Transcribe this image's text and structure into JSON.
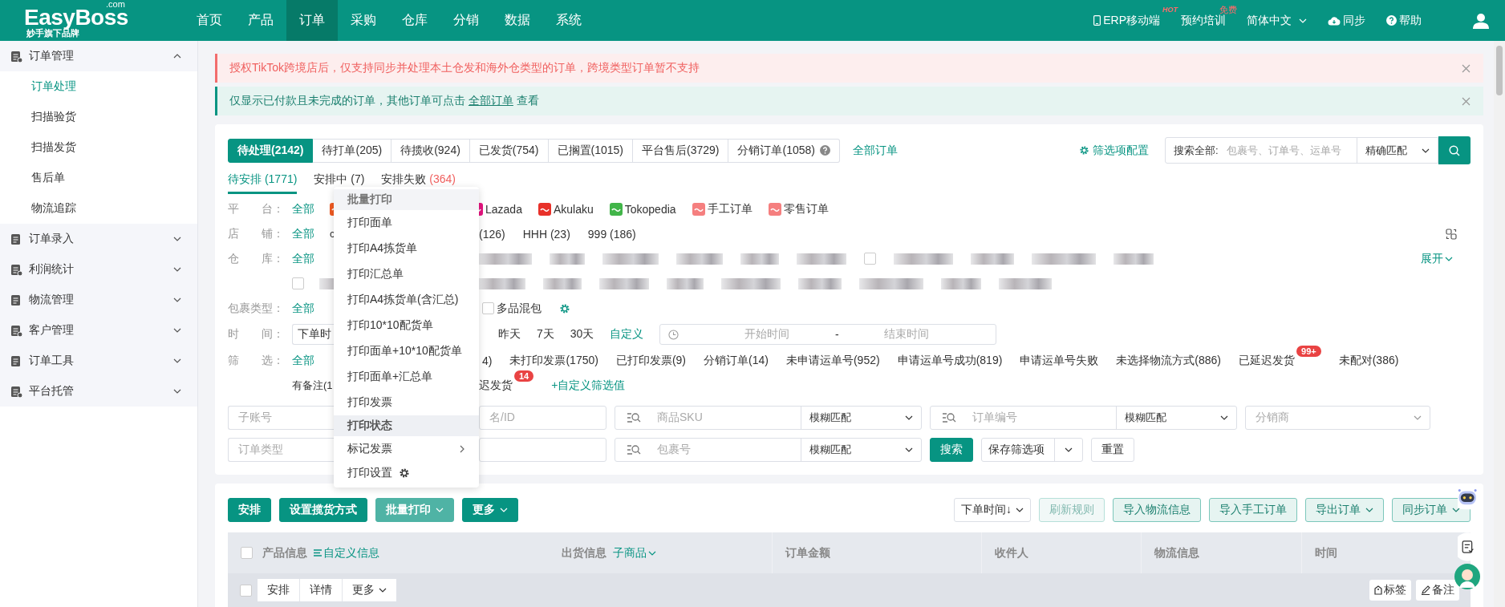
{
  "header": {
    "logo": "EasyBoss",
    "logo_suffix": ".com",
    "tagline": "妙手旗下品牌",
    "nav": [
      {
        "label": "首页",
        "selected": false
      },
      {
        "label": "产品",
        "selected": false
      },
      {
        "label": "订单",
        "selected": true
      },
      {
        "label": "采购",
        "selected": false
      },
      {
        "label": "仓库",
        "selected": false
      },
      {
        "label": "分销",
        "selected": false
      },
      {
        "label": "数据",
        "selected": false
      },
      {
        "label": "系统",
        "selected": false
      }
    ],
    "links": [
      {
        "kind": "mobile",
        "label": "ERP移动端",
        "badge": "HOT"
      },
      {
        "kind": "training",
        "label": "预约培训",
        "badge": "免费"
      },
      {
        "kind": "language",
        "label": "简体中文"
      },
      {
        "kind": "sync",
        "label": "同步"
      },
      {
        "kind": "help",
        "label": "帮助"
      },
      {
        "kind": "user"
      }
    ]
  },
  "sidebar": [
    {
      "label": "订单管理",
      "expanded": true,
      "children": [
        {
          "label": "订单处理",
          "selected": true
        },
        {
          "label": "扫描验货",
          "selected": false
        },
        {
          "label": "扫描发货",
          "selected": false
        },
        {
          "label": "售后单",
          "selected": false
        },
        {
          "label": "物流追踪",
          "selected": false
        }
      ]
    },
    {
      "label": "订单录入",
      "expanded": false
    },
    {
      "label": "利润统计",
      "expanded": false
    },
    {
      "label": "物流管理",
      "expanded": false
    },
    {
      "label": "客户管理",
      "expanded": false
    },
    {
      "label": "订单工具",
      "expanded": false
    },
    {
      "label": "平台托管",
      "expanded": false
    }
  ],
  "alerts": [
    {
      "kind": "warning",
      "text": "授权TikTok跨境店后，仅支持同步并处理本土仓发和海外仓类型的订单，跨境类型订单暂不支持"
    },
    {
      "kind": "info",
      "text": "仅显示已付款且未完成的订单，其他订单可点击 ",
      "link": "全部订单",
      "after": " 查看"
    }
  ],
  "status_tabs": [
    {
      "label": "待处理(2142)",
      "selected": true,
      "help": false
    },
    {
      "label": "待打单(205)",
      "selected": false,
      "help": false
    },
    {
      "label": "待揽收(924)",
      "selected": false,
      "help": false
    },
    {
      "label": "已发货(754)",
      "selected": false,
      "help": false
    },
    {
      "label": "已搁置(1015)",
      "selected": false,
      "help": false
    },
    {
      "label": "平台售后(3729)",
      "selected": false,
      "help": false
    },
    {
      "label": "分销订单(1058)",
      "selected": false,
      "help": true
    }
  ],
  "all_orders": "全部订单",
  "filter_config": "筛选项配置",
  "search": {
    "label": "搜索全部:",
    "placeholder": "包裹号、订单号、运单号",
    "match": "精确匹配"
  },
  "sub_tabs": [
    {
      "label": "待安排",
      "count": "(1771)",
      "selected": true,
      "error": false
    },
    {
      "label": "安排中",
      "count": "(7)",
      "selected": false,
      "error": false
    },
    {
      "label": "安排失败",
      "count": "(364)",
      "selected": false,
      "error": true
    }
  ],
  "filter_rows": [
    {
      "label": "平　　台：",
      "left": [
        {
          "kind": "link",
          "text": "全部"
        },
        {
          "kind": "platform",
          "color": "#f05a22"
        }
      ],
      "right": [
        {
          "kind": "platform",
          "text": "Lazada",
          "color": "#e5147f"
        },
        {
          "kind": "platform",
          "text": "Akulaku",
          "color": "#e8312a"
        },
        {
          "kind": "platform",
          "text": "Tokopedia",
          "color": "#42b549"
        },
        {
          "kind": "platform",
          "text": "手工订单",
          "color": "#f57f7f"
        },
        {
          "kind": "platform",
          "text": "零售订单",
          "color": "#f57f7f"
        }
      ]
    },
    {
      "label": "店　　铺：",
      "left": [
        {
          "kind": "link",
          "text": "全部"
        },
        {
          "kind": "text",
          "text": "c"
        }
      ],
      "right": [
        {
          "kind": "text",
          "text": "(126)"
        },
        {
          "kind": "text",
          "text": "HHH (23)"
        },
        {
          "kind": "text",
          "text": "999 (186)"
        }
      ],
      "copy": true
    },
    {
      "label": "仓　　库：",
      "left": [
        {
          "kind": "link",
          "text": "全部"
        }
      ],
      "right": [
        {
          "kind": "redacted"
        },
        {
          "kind": "redacted"
        },
        {
          "kind": "redacted"
        },
        {
          "kind": "redacted"
        },
        {
          "kind": "redacted"
        },
        {
          "kind": "redacted"
        },
        {
          "kind": "checkbox",
          "checked": false
        },
        {
          "kind": "redacted"
        },
        {
          "kind": "redacted"
        },
        {
          "kind": "redacted"
        },
        {
          "kind": "redacted"
        }
      ],
      "expand": "展开"
    },
    {
      "left": [
        {
          "kind": "checkbox",
          "checked": false
        },
        {
          "kind": "redacted"
        }
      ],
      "right": [
        {
          "kind": "redacted"
        },
        {
          "kind": "redacted"
        },
        {
          "kind": "redacted"
        },
        {
          "kind": "redacted"
        },
        {
          "kind": "redacted"
        },
        {
          "kind": "redacted"
        },
        {
          "kind": "redacted"
        },
        {
          "kind": "redacted"
        },
        {
          "kind": "redacted"
        }
      ]
    },
    {
      "label": "包裹类型：",
      "left": [
        {
          "kind": "link",
          "text": "全部"
        }
      ],
      "right": [
        {
          "kind": "checkbox",
          "checked": false,
          "text": "多品混包"
        },
        {
          "kind": "gear"
        }
      ]
    },
    {
      "label": "时　　间：",
      "left": [
        {
          "kind": "select",
          "text": "下单时"
        }
      ],
      "right": [
        {
          "kind": "text",
          "text": "昨天"
        },
        {
          "kind": "text",
          "text": "7天"
        },
        {
          "kind": "text",
          "text": "30天"
        },
        {
          "kind": "link",
          "text": "自定义"
        },
        {
          "kind": "date_range",
          "start": "开始时间",
          "separator": "-",
          "end": "结束时间"
        }
      ]
    },
    {
      "label": "筛　　选：",
      "left": [
        {
          "kind": "link",
          "text": "全部"
        }
      ],
      "right": [
        {
          "kind": "text",
          "text": "4)"
        },
        {
          "kind": "text",
          "text": "未打印发票(1750)"
        },
        {
          "kind": "text",
          "text": "已打印发票(9)"
        },
        {
          "kind": "text",
          "text": "分销订单(14)"
        },
        {
          "kind": "text",
          "text": "未申请运单号(952)"
        },
        {
          "kind": "text",
          "text": "申请运单号成功(819)"
        },
        {
          "kind": "text",
          "text": "申请运单号失败"
        },
        {
          "kind": "text",
          "text": "未选择物流方式(886)"
        },
        {
          "kind": "text",
          "text": "已延迟发货",
          "badge": "99+"
        },
        {
          "kind": "text",
          "text": "未配对(386)"
        }
      ]
    },
    {
      "left": [
        {
          "kind": "text",
          "text": "有备注(1"
        }
      ],
      "right": [
        {
          "kind": "text",
          "text": "迟发货",
          "badge": "14"
        },
        {
          "kind": "link",
          "text": "+自定义筛选值"
        }
      ]
    }
  ],
  "search_rows": [
    {
      "left": [
        {
          "kind": "input",
          "placeholder": "子账号"
        }
      ],
      "right": [
        {
          "kind": "input",
          "placeholder": "名/ID"
        },
        {
          "kind": "search_input",
          "placeholder": "商品SKU",
          "match": "模糊匹配"
        },
        {
          "kind": "search_input",
          "placeholder": "订单编号",
          "match": "模糊匹配"
        },
        {
          "kind": "select",
          "placeholder": "分销商"
        }
      ]
    },
    {
      "left": [
        {
          "kind": "input",
          "placeholder": "订单类型"
        }
      ],
      "right": [
        {
          "kind": "input"
        },
        {
          "kind": "search_input",
          "placeholder": "包裹号",
          "match": "模糊匹配"
        },
        {
          "kind": "primary",
          "label": "搜索"
        },
        {
          "kind": "split",
          "label": "保存筛选项"
        },
        {
          "kind": "plain",
          "label": "重置"
        }
      ]
    }
  ],
  "toolbar": {
    "left": [
      {
        "kind": "primary",
        "label": "安排",
        "open": false
      },
      {
        "kind": "primary",
        "label": "设置揽货方式",
        "open": false
      },
      {
        "kind": "dropdown",
        "label": "批量打印",
        "open": true
      },
      {
        "kind": "dropdown",
        "label": "更多",
        "open": false
      }
    ],
    "right": [
      {
        "kind": "select",
        "label": "下单时间↓",
        "disabled": false
      },
      {
        "kind": "outline",
        "label": "刷新规则",
        "disabled": true
      },
      {
        "kind": "outline",
        "label": "导入物流信息",
        "disabled": false
      },
      {
        "kind": "outline",
        "label": "导入手工订单",
        "disabled": false
      },
      {
        "kind": "dropdown",
        "label": "导出订单",
        "disabled": false
      },
      {
        "kind": "dropdown",
        "label": "同步订单",
        "disabled": false
      }
    ]
  },
  "table": {
    "checked": false,
    "columns": [
      {
        "label": "产品信息",
        "extra": "自定义信息"
      },
      {
        "label": "出货信息",
        "extra": "子商品"
      },
      {
        "label": "订单金额"
      },
      {
        "label": "收件人"
      },
      {
        "label": "物流信息"
      },
      {
        "label": "时间"
      }
    ],
    "order": {
      "checked": false,
      "actions": [
        "安排",
        "详情",
        "更多"
      ],
      "tools": [
        "标签",
        "备注"
      ]
    }
  },
  "menu": {
    "items": [
      {
        "kind": "header",
        "label": "批量打印"
      },
      {
        "kind": "item",
        "label": "打印面单",
        "highlighted": false
      },
      {
        "kind": "item",
        "label": "打印A4拣货单",
        "highlighted": false
      },
      {
        "kind": "item",
        "label": "打印汇总单",
        "highlighted": false
      },
      {
        "kind": "item",
        "label": "打印A4拣货单(含汇总)",
        "highlighted": false
      },
      {
        "kind": "item",
        "label": "打印10*10配货单",
        "highlighted": false
      },
      {
        "kind": "item",
        "label": "打印面单+10*10配货单",
        "highlighted": false
      },
      {
        "kind": "item",
        "label": "打印面单+汇总单",
        "highlighted": false
      },
      {
        "kind": "item",
        "label": "打印发票",
        "highlighted": false
      },
      {
        "kind": "item",
        "label": "打印状态",
        "highlighted": true
      },
      {
        "kind": "submenu",
        "label": "标记发票",
        "highlighted": false
      },
      {
        "kind": "settings",
        "label": "打印设置",
        "highlighted": false
      }
    ]
  }
}
